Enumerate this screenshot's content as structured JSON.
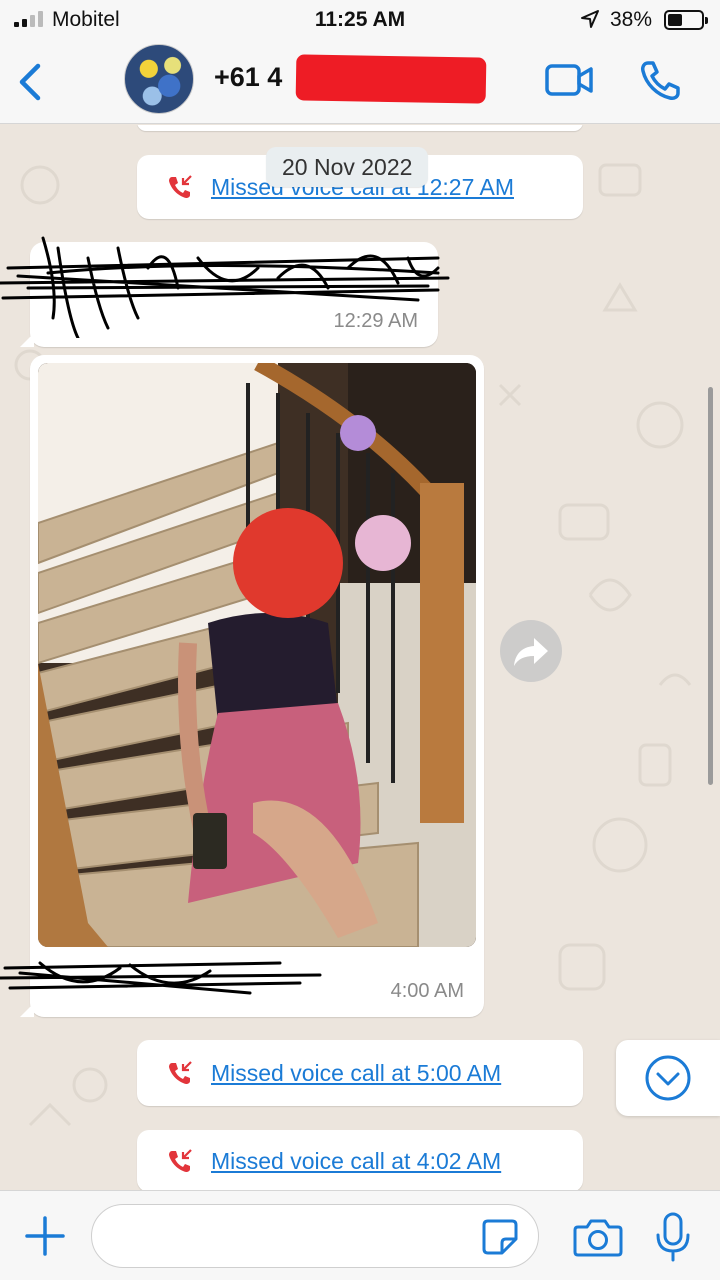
{
  "status_bar": {
    "carrier": "Mobitel",
    "time": "11:25 AM",
    "battery": "38%"
  },
  "header": {
    "contact_name": "+61 4"
  },
  "chat": {
    "date_separator": "20 Nov 2022",
    "missed_call_1": "Missed voice call at 12:27 AM",
    "message_1_time": "12:29 AM",
    "photo_message_time": "4:00 AM",
    "missed_call_2": "Missed voice call at 5:00 AM",
    "missed_call_3": "Missed voice call at 4:02 AM"
  },
  "colors": {
    "accent": "#1b7bd6",
    "missed_call": "#e2353b",
    "redaction": "#ee1c25"
  }
}
